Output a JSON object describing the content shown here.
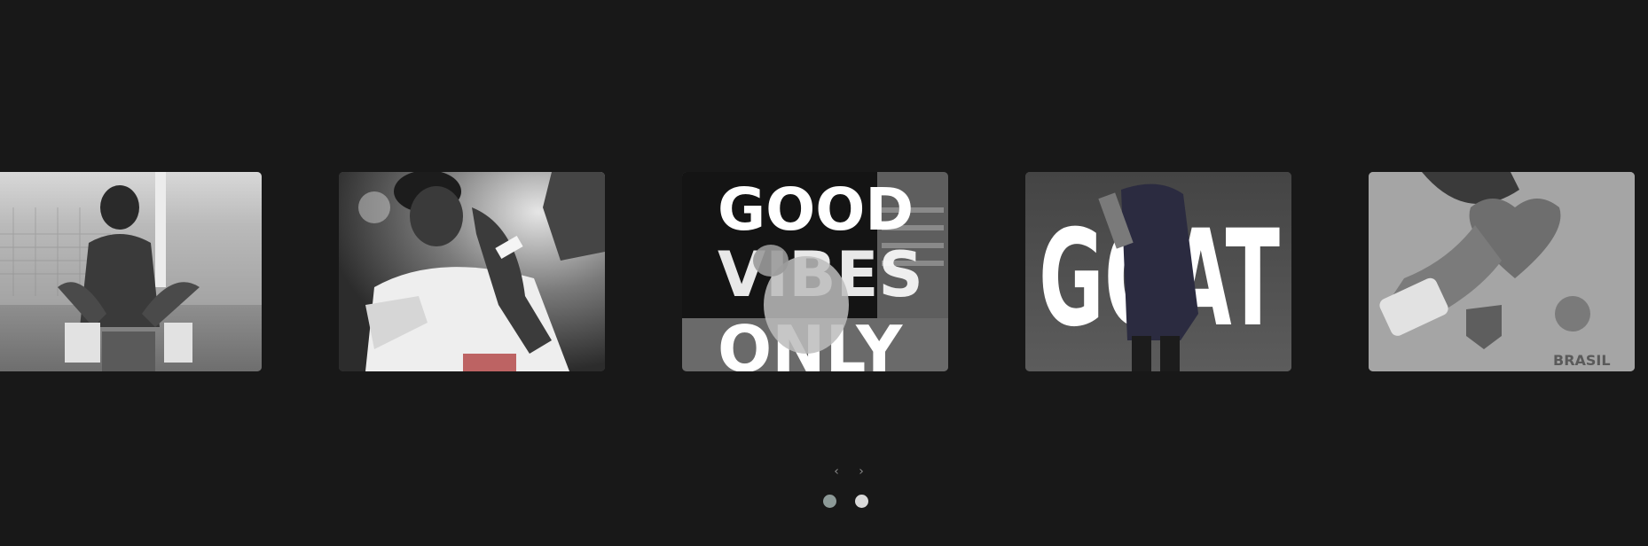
{
  "carousel": {
    "slides": [
      {
        "image": "player-sitting-on-pitch-photo"
      },
      {
        "image": "player-in-santos-kit-photo"
      },
      {
        "image": "good-vibes-only-poster",
        "overlay_text": [
          "GOOD",
          "VIBES",
          "ONLY"
        ]
      },
      {
        "image": "goat-poster",
        "overlay_text": "GOAT"
      },
      {
        "image": "heart-hands-brazil-kit-photo",
        "overlay_text": "BRASIL"
      }
    ],
    "prev_icon": "chevron-left-icon",
    "next_icon": "chevron-right-icon",
    "prev_glyph": "‹",
    "next_glyph": "›",
    "pagination": {
      "count": 2,
      "active_index": 0
    },
    "colors": {
      "background": "#181818",
      "dot_active": "#8d9a98",
      "dot_inactive": "#d9d9d9"
    }
  }
}
